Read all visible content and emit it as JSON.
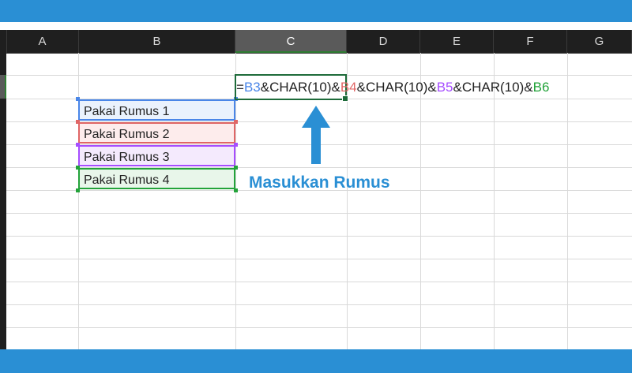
{
  "columns": [
    "A",
    "B",
    "C",
    "D",
    "E",
    "F",
    "G"
  ],
  "cells": {
    "B3": "Pakai Rumus 1",
    "B4": "Pakai Rumus 2",
    "B5": "Pakai Rumus 3",
    "B6": "Pakai Rumus 4"
  },
  "formula": {
    "eq": "=",
    "ref1": "B3",
    "part1": "&CHAR(10)&",
    "ref2": "B4",
    "part2": "&CHAR(10)&",
    "ref3": "B5",
    "part3": "&CHAR(10)&",
    "ref4": "B6"
  },
  "annotation": "Masukkan Rumus",
  "colors": {
    "frame": "#2a8fd4",
    "ref1": "#4a86e8",
    "ref2": "#e06666",
    "ref3": "#a64dff",
    "ref4": "#23a33a",
    "selection": "#1e6b3a"
  },
  "icons": {
    "arrow": "arrow-up-icon"
  }
}
